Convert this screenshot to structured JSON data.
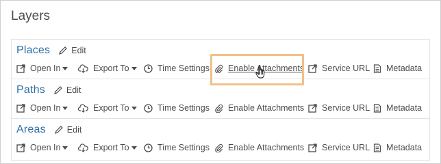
{
  "page": {
    "title": "Layers"
  },
  "actions_labels": {
    "open_in": "Open In",
    "export_to": "Export To",
    "time_settings": "Time Settings",
    "enable_attachments": "Enable Attachments",
    "service_url": "Service URL",
    "metadata": "Metadata",
    "edit": "Edit"
  },
  "layers": [
    {
      "name": "Places",
      "edit": "Edit",
      "open_in": "Open In",
      "export_to": "Export To",
      "time_settings": "Time Settings",
      "enable_attachments": "Enable Attachments",
      "service_url": "Service URL",
      "metadata": "Metadata"
    },
    {
      "name": "Paths",
      "edit": "Edit",
      "open_in": "Open In",
      "export_to": "Export To",
      "time_settings": "Time Settings",
      "enable_attachments": "Enable Attachments",
      "service_url": "Service URL",
      "metadata": "Metadata"
    },
    {
      "name": "Areas",
      "edit": "Edit",
      "open_in": "Open In",
      "export_to": "Export To",
      "time_settings": "Time Settings",
      "enable_attachments": "Enable Attachments",
      "service_url": "Service URL",
      "metadata": "Metadata"
    }
  ],
  "highlight": {
    "target": "enable_attachments",
    "layer_index": 0,
    "color": "#f0c189"
  },
  "colors": {
    "layer_name": "#2e6ea6",
    "text": "#4c4c4c",
    "border": "#e3e3e3"
  },
  "icons": {
    "edit": "pencil-icon",
    "open_in": "open-in-new-icon",
    "export_to": "cloud-download-icon",
    "time_settings": "clock-icon",
    "enable_attachments": "paperclip-icon",
    "service_url": "external-link-icon",
    "metadata": "document-icon",
    "cursor": "hand-pointer-icon"
  }
}
